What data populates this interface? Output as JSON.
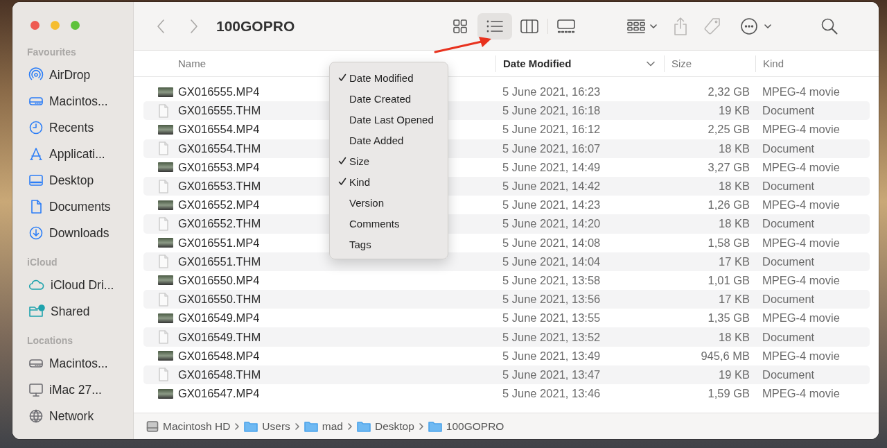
{
  "window": {
    "title": "100GOPRO"
  },
  "sidebar": {
    "sections": [
      {
        "heading": "Favourites",
        "items": [
          {
            "label": "AirDrop"
          },
          {
            "label": "Macintos..."
          },
          {
            "label": "Recents"
          },
          {
            "label": "Applicati..."
          },
          {
            "label": "Desktop"
          },
          {
            "label": "Documents"
          },
          {
            "label": "Downloads"
          }
        ]
      },
      {
        "heading": "iCloud",
        "items": [
          {
            "label": "iCloud Dri..."
          },
          {
            "label": "Shared"
          }
        ]
      },
      {
        "heading": "Locations",
        "items": [
          {
            "label": "Macintos..."
          },
          {
            "label": "iMac 27..."
          },
          {
            "label": "Network"
          }
        ]
      }
    ]
  },
  "toolbar": {
    "view_buttons": [
      {
        "selected": false
      },
      {
        "selected": true
      },
      {
        "selected": false
      },
      {
        "selected": false
      }
    ],
    "actions": [
      {
        "disabled": false
      },
      {
        "disabled": true
      },
      {
        "disabled": true
      },
      {
        "disabled": false
      }
    ]
  },
  "table": {
    "columns": [
      {
        "label": "Name",
        "sorted": false
      },
      {
        "label": "Date Modified",
        "sorted": true
      },
      {
        "label": "Size",
        "sorted": false
      },
      {
        "label": "Kind",
        "sorted": false
      }
    ],
    "rows": [
      {
        "kind": "video",
        "name": "GX016555.MP4",
        "date": "5 June 2021, 16:23",
        "size": "2,32 GB",
        "kind_label": "MPEG-4 movie"
      },
      {
        "kind": "document",
        "name": "GX016555.THM",
        "date": "5 June 2021, 16:18",
        "size": "19 KB",
        "kind_label": "Document"
      },
      {
        "kind": "video",
        "name": "GX016554.MP4",
        "date": "5 June 2021, 16:12",
        "size": "2,25 GB",
        "kind_label": "MPEG-4 movie"
      },
      {
        "kind": "document",
        "name": "GX016554.THM",
        "date": "5 June 2021, 16:07",
        "size": "18 KB",
        "kind_label": "Document"
      },
      {
        "kind": "video",
        "name": "GX016553.MP4",
        "date": "5 June 2021, 14:49",
        "size": "3,27 GB",
        "kind_label": "MPEG-4 movie"
      },
      {
        "kind": "document",
        "name": "GX016553.THM",
        "date": "5 June 2021, 14:42",
        "size": "18 KB",
        "kind_label": "Document"
      },
      {
        "kind": "video",
        "name": "GX016552.MP4",
        "date": "5 June 2021, 14:23",
        "size": "1,26 GB",
        "kind_label": "MPEG-4 movie"
      },
      {
        "kind": "document",
        "name": "GX016552.THM",
        "date": "5 June 2021, 14:20",
        "size": "18 KB",
        "kind_label": "Document"
      },
      {
        "kind": "video",
        "name": "GX016551.MP4",
        "date": "5 June 2021, 14:08",
        "size": "1,58 GB",
        "kind_label": "MPEG-4 movie"
      },
      {
        "kind": "document",
        "name": "GX016551.THM",
        "date": "5 June 2021, 14:04",
        "size": "17 KB",
        "kind_label": "Document"
      },
      {
        "kind": "video",
        "name": "GX016550.MP4",
        "date": "5 June 2021, 13:58",
        "size": "1,01 GB",
        "kind_label": "MPEG-4 movie"
      },
      {
        "kind": "document",
        "name": "GX016550.THM",
        "date": "5 June 2021, 13:56",
        "size": "17 KB",
        "kind_label": "Document"
      },
      {
        "kind": "video",
        "name": "GX016549.MP4",
        "date": "5 June 2021, 13:55",
        "size": "1,35 GB",
        "kind_label": "MPEG-4 movie"
      },
      {
        "kind": "document",
        "name": "GX016549.THM",
        "date": "5 June 2021, 13:52",
        "size": "18 KB",
        "kind_label": "Document"
      },
      {
        "kind": "video",
        "name": "GX016548.MP4",
        "date": "5 June 2021, 13:49",
        "size": "945,6 MB",
        "kind_label": "MPEG-4 movie"
      },
      {
        "kind": "document",
        "name": "GX016548.THM",
        "date": "5 June 2021, 13:47",
        "size": "19 KB",
        "kind_label": "Document"
      },
      {
        "kind": "video",
        "name": "GX016547.MP4",
        "date": "5 June 2021, 13:46",
        "size": "1,59 GB",
        "kind_label": "MPEG-4 movie"
      }
    ]
  },
  "column_menu": {
    "items": [
      {
        "label": "Date Modified",
        "checked": true
      },
      {
        "label": "Date Created",
        "checked": false
      },
      {
        "label": "Date Last Opened",
        "checked": false
      },
      {
        "label": "Date Added",
        "checked": false
      },
      {
        "label": "Size",
        "checked": true
      },
      {
        "label": "Kind",
        "checked": true
      },
      {
        "label": "Version",
        "checked": false
      },
      {
        "label": "Comments",
        "checked": false
      },
      {
        "label": "Tags",
        "checked": false
      }
    ]
  },
  "path_bar": {
    "items": [
      {
        "kind": "disk",
        "label": "Macintosh HD"
      },
      {
        "kind": "folder",
        "label": "Users"
      },
      {
        "kind": "folder",
        "label": "mad"
      },
      {
        "kind": "folder",
        "label": "Desktop"
      },
      {
        "kind": "folder",
        "label": "100GOPRO"
      }
    ]
  }
}
